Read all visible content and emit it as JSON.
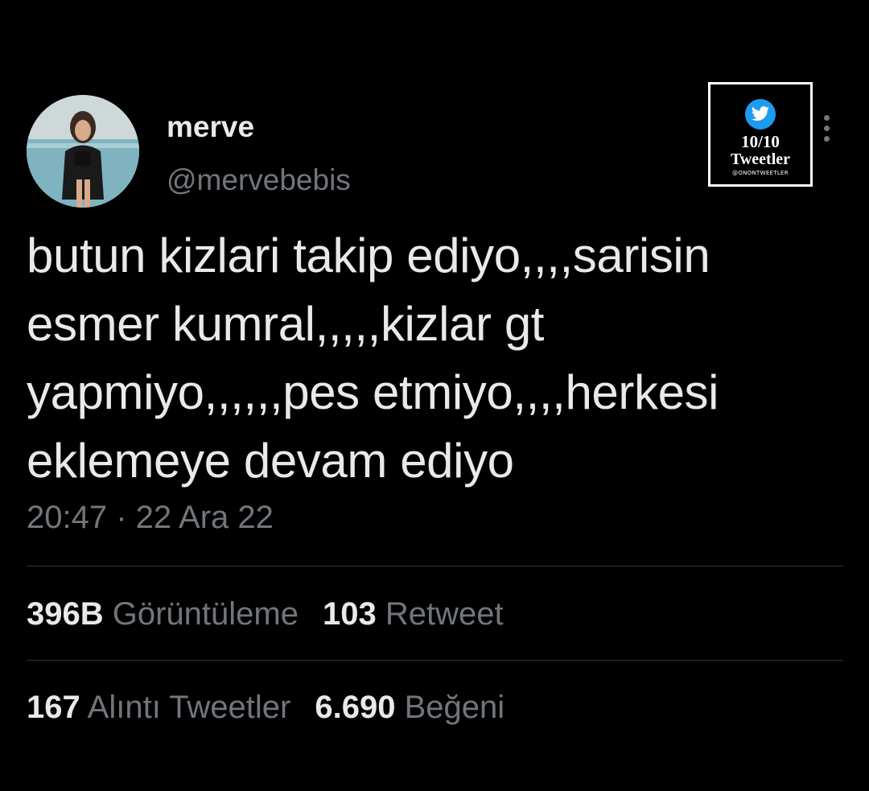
{
  "user": {
    "display_name": "merve",
    "handle": "@mervebebis"
  },
  "badge": {
    "icon": "twitter-bird-icon",
    "score": "10/10",
    "title": "Tweetler",
    "handle": "@ONONTWEETLER",
    "accent": "#1d9bf0"
  },
  "tweet": {
    "lines": [
      "butun kizlari takip ediyo,,,,sarisin",
      "esmer kumral,,,,,kizlar gt",
      "yapmiyo,,,,,,pes etmiyo,,,,herkesi",
      "eklemeye devam ediyo"
    ],
    "timestamp": "20:47 · 22 Ara 22"
  },
  "stats": {
    "views": {
      "count": "396B",
      "label": "Görüntüleme"
    },
    "retweets": {
      "count": "103",
      "label": "Retweet"
    },
    "quotes": {
      "count": "167",
      "label": "Alıntı Tweetler"
    },
    "likes": {
      "count": "6.690",
      "label": "Beğeni"
    }
  },
  "colors": {
    "background": "#000000",
    "primary_text": "#e7e9ea",
    "secondary_text": "#71767b",
    "divider": "#2f3336"
  }
}
